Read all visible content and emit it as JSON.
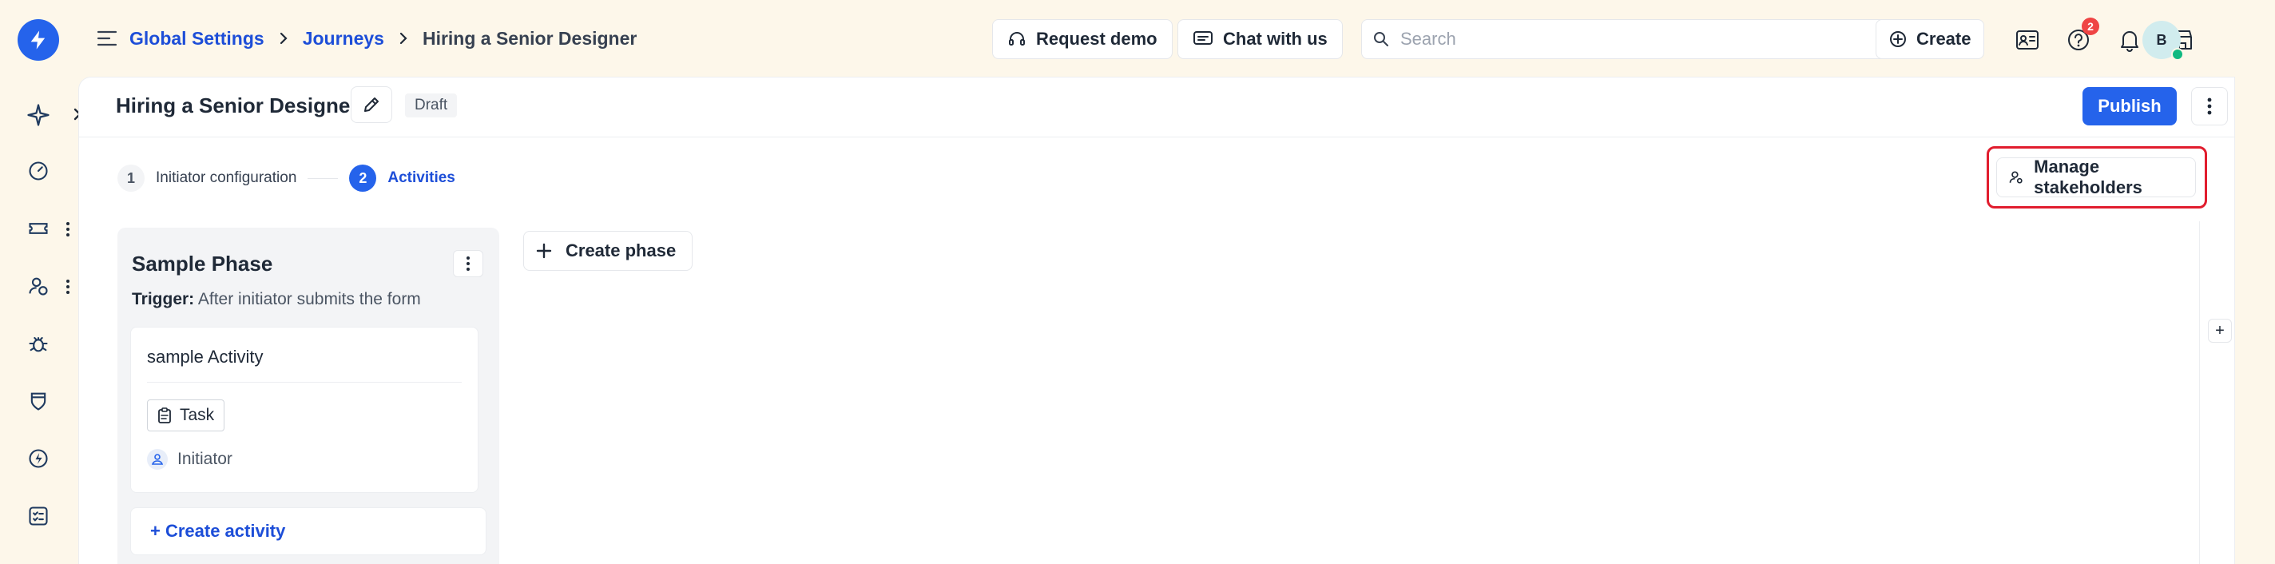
{
  "colors": {
    "accent": "#2563eb",
    "brand_bg": "#fdf7ea",
    "highlight": "#e11d2e"
  },
  "rail": {
    "items": [
      {
        "icon": "sparkle-icon"
      },
      {
        "icon": "dashboard-icon"
      },
      {
        "icon": "ticket-icon"
      },
      {
        "icon": "people-icon"
      },
      {
        "icon": "bug-icon"
      },
      {
        "icon": "shield-icon"
      },
      {
        "icon": "bolt-icon"
      },
      {
        "icon": "checklist-icon"
      }
    ]
  },
  "breadcrumb": {
    "items": [
      "Global Settings",
      "Journeys"
    ],
    "current": "Hiring a Senior Designer"
  },
  "topbar": {
    "request_demo": "Request demo",
    "chat": "Chat with us",
    "search_placeholder": "Search",
    "search_shortcut": "/",
    "create": "Create",
    "help_badge": "2",
    "avatar_initial": "B"
  },
  "page": {
    "title": "Hiring a Senior Designer",
    "status": "Draft",
    "publish": "Publish"
  },
  "stepper": {
    "steps": [
      {
        "num": "1",
        "label": "Initiator configuration"
      },
      {
        "num": "2",
        "label": "Activities"
      }
    ],
    "active_step": 2
  },
  "manage_stakeholders": "Manage stakeholders",
  "phase": {
    "title": "Sample Phase",
    "trigger_label": "Trigger:",
    "trigger_value": "After initiator submits the form",
    "activity": {
      "title": "sample Activity",
      "type": "Task",
      "assignee": "Initiator"
    },
    "create_activity": "+ Create activity"
  },
  "create_phase": "Create phase",
  "side_add": "+"
}
